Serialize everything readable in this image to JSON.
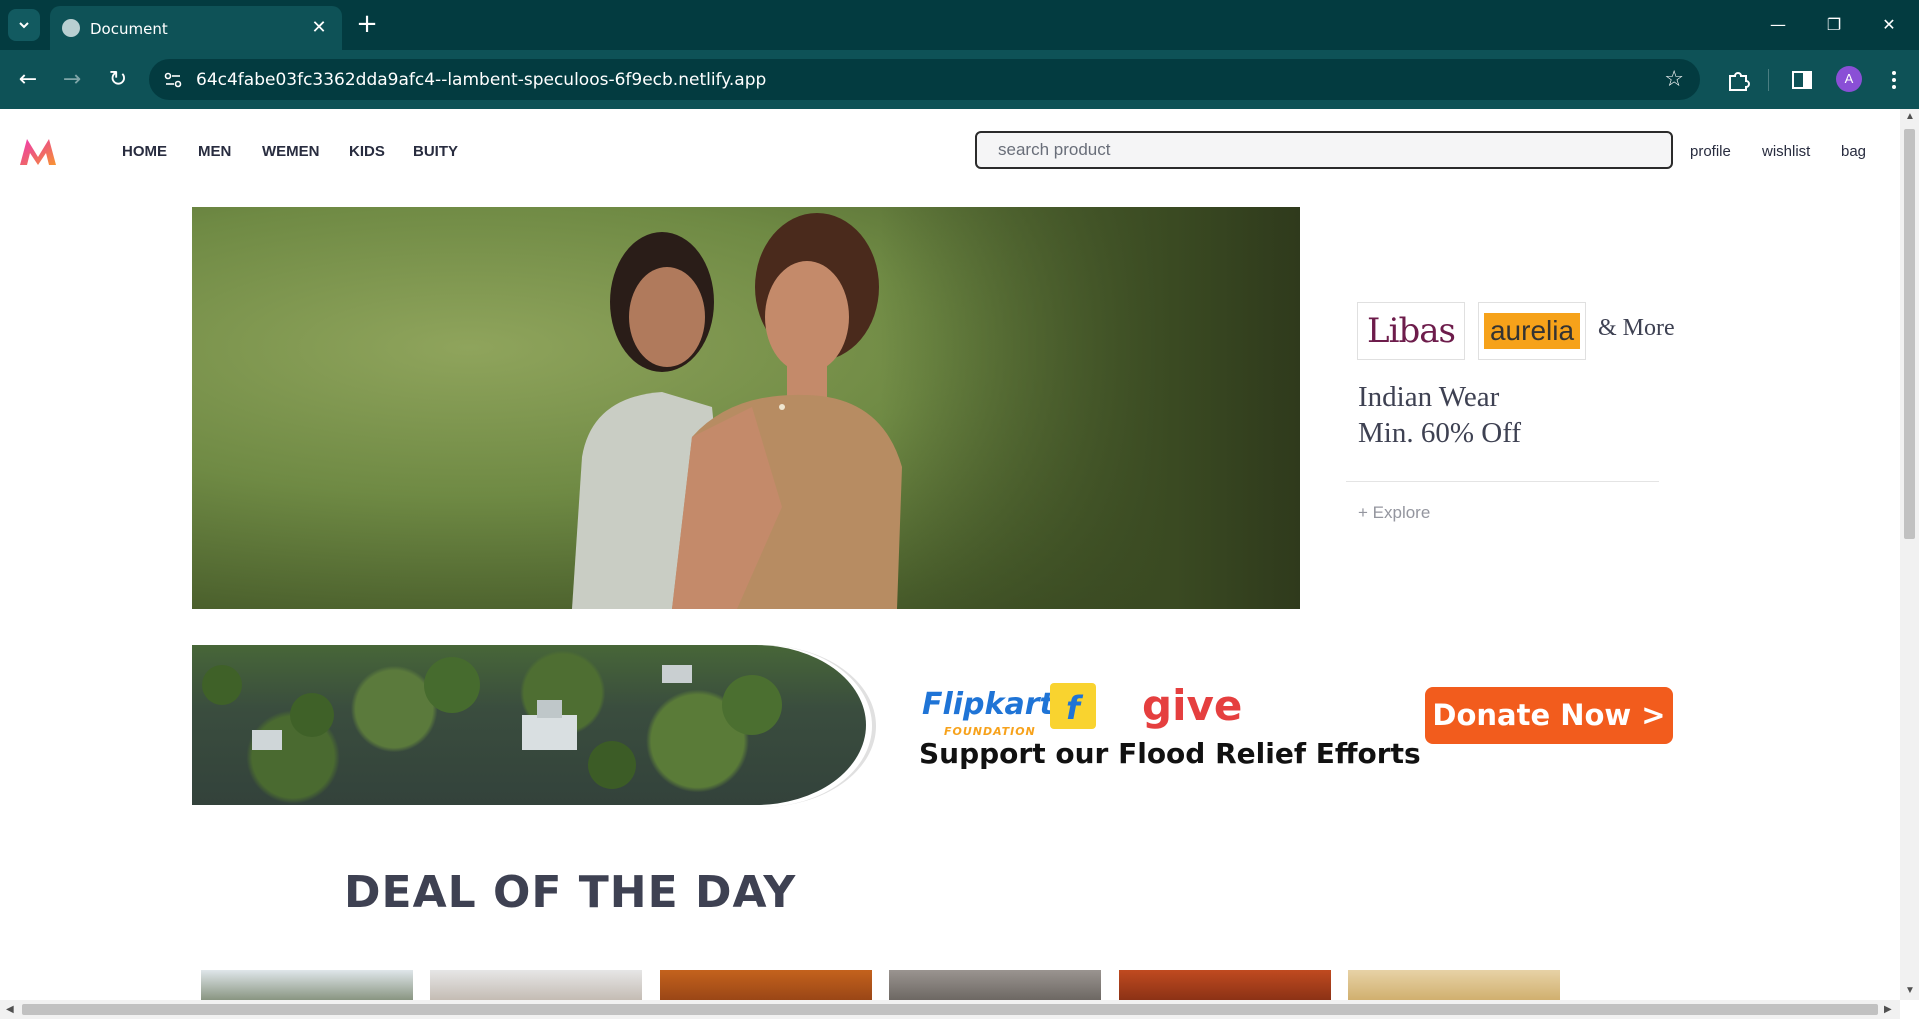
{
  "browser": {
    "tab_title": "Document",
    "url": "64c4fabe03fc3362dda9afc4--lambent-speculoos-6f9ecb.netlify.app",
    "profile_initial": "A"
  },
  "site": {
    "nav": [
      "HOME",
      "MEN",
      "WEMEN",
      "KIDS",
      "BUITY"
    ],
    "search_placeholder": "search product",
    "actions": [
      "profile",
      "wishlist",
      "bag"
    ]
  },
  "hero": {
    "brands": [
      "Libas",
      "aurelia"
    ],
    "and_more": "& More",
    "offer_line1": "Indian Wear",
    "offer_line2": "Min. 60% Off",
    "explore": "+ Explore"
  },
  "flood_banner": {
    "brand": "Flipkart",
    "brand_sub": "FOUNDATION",
    "give": "give",
    "headline": "Support our Flood Relief Efforts",
    "cta": "Donate Now >"
  },
  "deal": {
    "title": "DEAL OF THE DAY",
    "thumbnails": 6
  },
  "colors": {
    "chrome_dark": "#033b40",
    "chrome_toolbar": "#0e5257",
    "text_primary": "#282c3f",
    "donate_orange": "#f25c1d",
    "flipkart_blue": "#1f74d6",
    "give_red": "#e53f3f"
  }
}
